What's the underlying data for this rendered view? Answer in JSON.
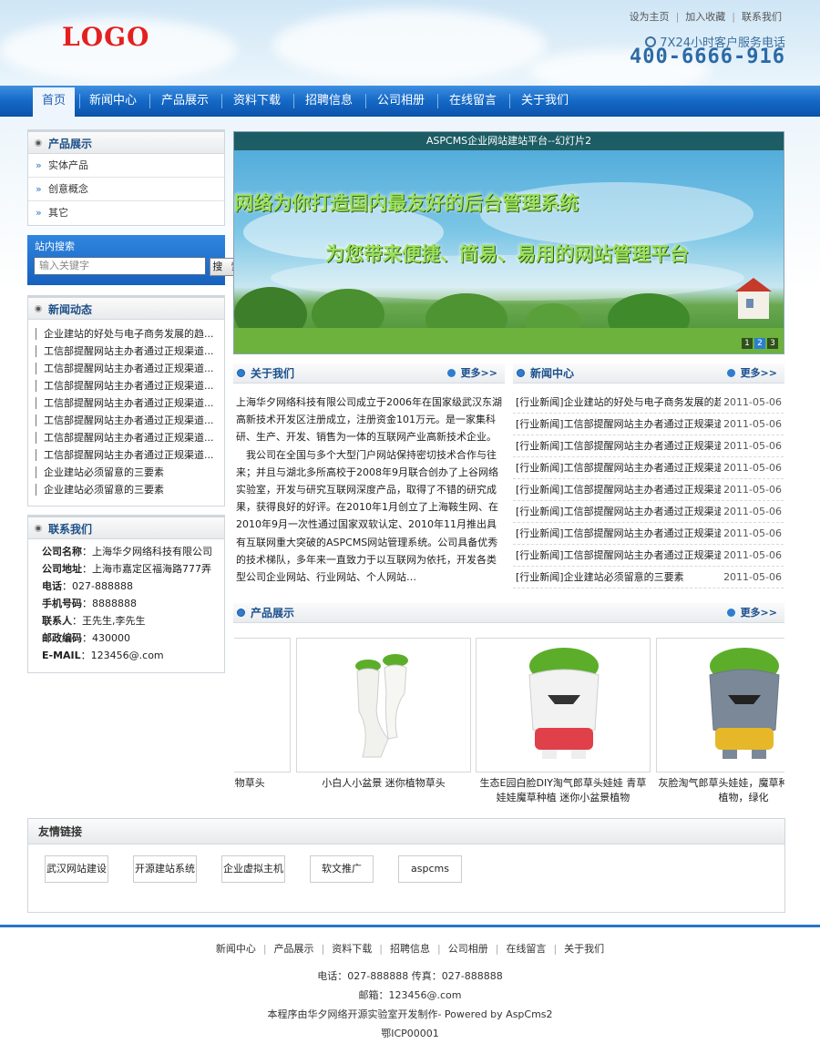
{
  "header": {
    "logo": "LOGO",
    "top_links": [
      "设为主页",
      "加入收藏",
      "联系我们"
    ],
    "hotline_label": "7X24小时客户服务电话",
    "hotline_phone": "400-6666-916"
  },
  "nav": [
    "首页",
    "新闻中心",
    "产品展示",
    "资料下载",
    "招聘信息",
    "公司相册",
    "在线留言",
    "关于我们"
  ],
  "sidebar": {
    "product_title": "产品展示",
    "product_categories": [
      "实体产品",
      "创意概念",
      "其它"
    ],
    "search_title": "站内搜索",
    "search_placeholder": "输入关键字",
    "search_button": "搜 索",
    "news_title": "新闻动态",
    "news_items": [
      "企业建站的好处与电子商务发展的趋...",
      "工信部提醒网站主办者通过正规渠道...",
      "工信部提醒网站主办者通过正规渠道...",
      "工信部提醒网站主办者通过正规渠道...",
      "工信部提醒网站主办者通过正规渠道...",
      "工信部提醒网站主办者通过正规渠道...",
      "工信部提醒网站主办者通过正规渠道...",
      "工信部提醒网站主办者通过正规渠道...",
      "企业建站必须留意的三要素",
      "企业建站必须留意的三要素"
    ],
    "contact_title": "联系我们",
    "contact": [
      {
        "label": "公司名称",
        "value": "上海华夕网络科技有限公司"
      },
      {
        "label": "公司地址",
        "value": "上海市嘉定区福海路777弄"
      },
      {
        "label": "电话",
        "value": "027-888888"
      },
      {
        "label": "手机号码",
        "value": "8888888"
      },
      {
        "label": "联系人",
        "value": "王先生,李先生"
      },
      {
        "label": "邮政编码",
        "value": "430000"
      },
      {
        "label": "E-MAIL",
        "value": "123456@.com"
      }
    ]
  },
  "banner": {
    "caption": "ASPCMS企业网站建站平台--幻灯片2",
    "line1": "网络为你打造国内最友好的后台管理系统",
    "line2": "为您带来便捷、简易、易用的网站管理平台",
    "pages": [
      "1",
      "2",
      "3"
    ]
  },
  "about": {
    "title": "关于我们",
    "more": "更多>>",
    "para1": "上海华夕网络科技有限公司成立于2006年在国家级武汉东湖高新技术开发区注册成立，注册资金101万元。是一家集科研、生产、开发、销售为一体的互联网产业高新技术企业。",
    "para2": "　我公司在全国与多个大型门户网站保持密切技术合作与往来；并且与湖北多所高校于2008年9月联合创办了上谷网络实验室，开发与研究互联网深度产品，取得了不错的研究成果，获得良好的好评。在2010年1月创立了上海鞍生网、在2010年9月一次性通过国家双软认定、2010年11月推出具有互联网重大突破的ASPCMS网站管理系统。公司具备优秀的技术梯队，多年来一直致力于以互联网为依托，开发各类型公司企业网站、行业网站、个人网站…"
  },
  "news_center": {
    "title": "新闻中心",
    "more": "更多>>",
    "items": [
      {
        "title": "[行业新闻]企业建站的好处与电子商务发展的趋",
        "date": "2011-05-06"
      },
      {
        "title": "[行业新闻]工信部提醒网站主办者通过正规渠道",
        "date": "2011-05-06"
      },
      {
        "title": "[行业新闻]工信部提醒网站主办者通过正规渠道",
        "date": "2011-05-06"
      },
      {
        "title": "[行业新闻]工信部提醒网站主办者通过正规渠道",
        "date": "2011-05-06"
      },
      {
        "title": "[行业新闻]工信部提醒网站主办者通过正规渠道",
        "date": "2011-05-06"
      },
      {
        "title": "[行业新闻]工信部提醒网站主办者通过正规渠道",
        "date": "2011-05-06"
      },
      {
        "title": "[行业新闻]工信部提醒网站主办者通过正规渠道",
        "date": "2011-05-06"
      },
      {
        "title": "[行业新闻]工信部提醒网站主办者通过正规渠道",
        "date": "2011-05-06"
      },
      {
        "title": "[行业新闻]企业建站必须留意的三要素",
        "date": "2011-05-06"
      }
    ]
  },
  "products": {
    "title": "产品展示",
    "more": "更多>>",
    "items": [
      "小白人小盆景 迷你植物草头",
      "小白人小盆景 迷你植物草头",
      "生态E园白脸DIY淘气郎草头娃娃 青草娃娃魔草种植 迷你小盆景植物",
      "灰脸淘气郎草头娃娃，魔草种植，迷你植物，绿化"
    ]
  },
  "friends": {
    "title": "友情链接",
    "links": [
      "武汉网站建设",
      "开源建站系统",
      "企业虚拟主机",
      "软文推广",
      "aspcms"
    ]
  },
  "footer": {
    "nav": [
      "新闻中心",
      "产品展示",
      "资料下载",
      "招聘信息",
      "公司相册",
      "在线留言",
      "关于我们"
    ],
    "phone_line": "电话：027-888888 传真：027-888888",
    "email_line": "邮箱：123456@.com",
    "powered_line": "本程序由华夕网络开源实验室开发制作- Powered by AspCms2",
    "icp": "鄂ICP00001"
  }
}
